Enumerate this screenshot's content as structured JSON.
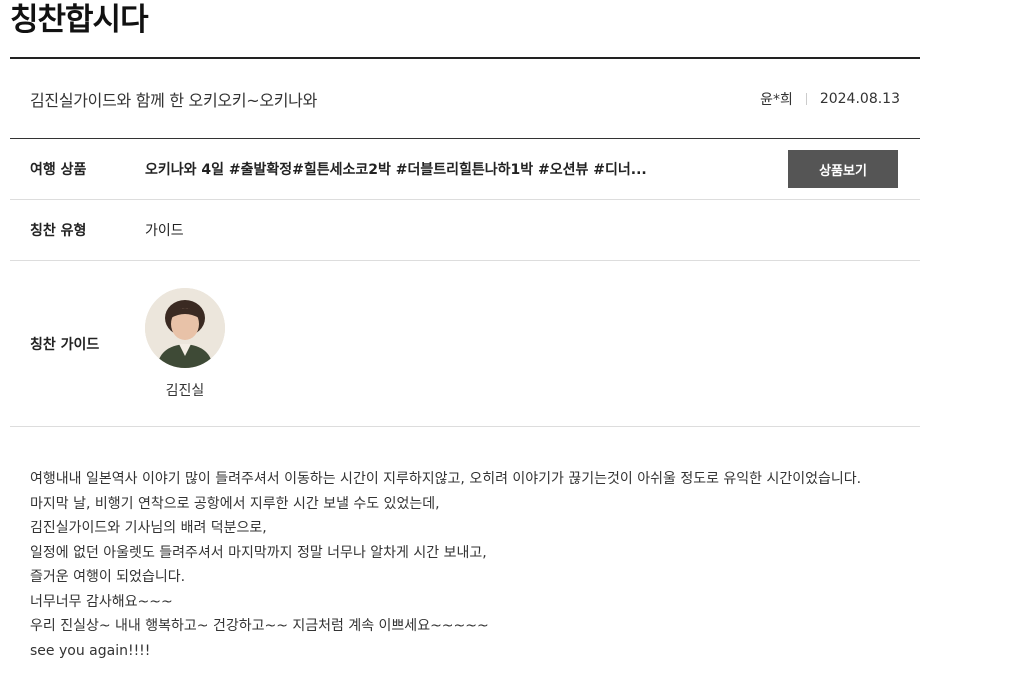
{
  "page": {
    "title": "칭찬합시다"
  },
  "post": {
    "title": "김진실가이드와 함께 한 오키오키~오키나와",
    "author": "윤*희",
    "date": "2024.08.13"
  },
  "product": {
    "label": "여행 상품",
    "value": "오키나와 4일 #출발확정#힐튼세소코2박 #더블트리힐튼나하1박 #오션뷰 #디너...",
    "button_label": "상품보기"
  },
  "praise_type": {
    "label": "칭찬 유형",
    "value": "가이드"
  },
  "guide": {
    "label": "칭찬 가이드",
    "name": "김진실"
  },
  "content": {
    "lines": [
      "여행내내 일본역사 이야기 많이 들려주셔서 이동하는 시간이 지루하지않고, 오히려 이야기가 끊기는것이 아쉬울 정도로 유익한 시간이었습니다.",
      "마지막 날, 비행기 연착으로 공항에서 지루한 시간 보낼 수도 있었는데,",
      "김진실가이드와 기사님의 배려 덕분으로,",
      "일정에 없던 아울렛도 들려주셔서 마지막까지 정말 너무나 알차게 시간 보내고,",
      "즐거운 여행이 되었습니다.",
      "너무너무 감사해요~~~",
      "우리 진실상~ 내내 행복하고~ 건강하고~~ 지금처럼 계속 이쁘세요~~~~~",
      "see you again!!!!"
    ]
  }
}
